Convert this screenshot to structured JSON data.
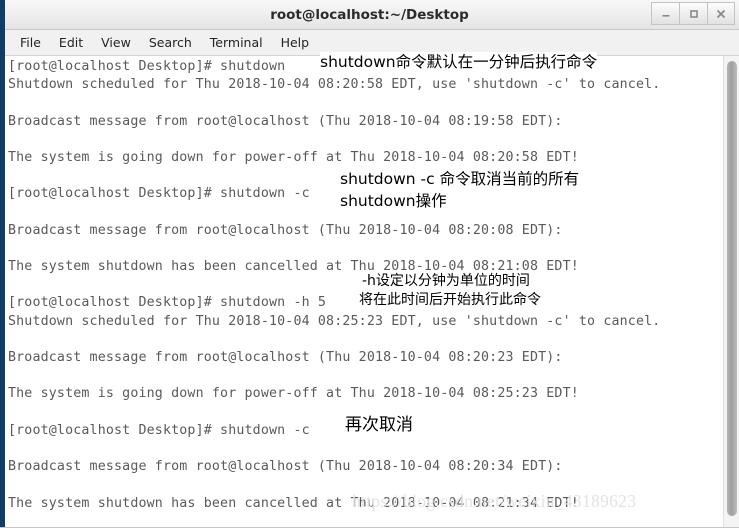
{
  "window": {
    "title": "root@localhost:~/Desktop",
    "frame_color": "#0f3d68",
    "titlebar_bg": "#eeeeee",
    "controls": [
      {
        "name": "minimize",
        "glyph": "–"
      },
      {
        "name": "maximize",
        "glyph": "□"
      },
      {
        "name": "close",
        "glyph": "✕"
      }
    ]
  },
  "menubar": {
    "items": [
      {
        "label": "File"
      },
      {
        "label": "Edit"
      },
      {
        "label": "View"
      },
      {
        "label": "Search"
      },
      {
        "label": "Terminal"
      },
      {
        "label": "Help"
      }
    ]
  },
  "terminal": {
    "text_color": "#5a5a5a",
    "background": "#ffffff",
    "lines": [
      "[root@localhost Desktop]# shutdown",
      "Shutdown scheduled for Thu 2018-10-04 08:20:58 EDT, use 'shutdown -c' to cancel.",
      "",
      "Broadcast message from root@localhost (Thu 2018-10-04 08:19:58 EDT):",
      "",
      "The system is going down for power-off at Thu 2018-10-04 08:20:58 EDT!",
      "",
      "[root@localhost Desktop]# shutdown -c",
      "",
      "Broadcast message from root@localhost (Thu 2018-10-04 08:20:08 EDT):",
      "",
      "The system shutdown has been cancelled at Thu 2018-10-04 08:21:08 EDT!",
      "",
      "[root@localhost Desktop]# shutdown -h 5",
      "Shutdown scheduled for Thu 2018-10-04 08:25:23 EDT, use 'shutdown -c' to cancel.",
      "",
      "Broadcast message from root@localhost (Thu 2018-10-04 08:20:23 EDT):",
      "",
      "The system is going down for power-off at Thu 2018-10-04 08:25:23 EDT!",
      "",
      "[root@localhost Desktop]# shutdown -c",
      "",
      "Broadcast message from root@localhost (Thu 2018-10-04 08:20:34 EDT):",
      "",
      "The system shutdown has been cancelled at Thu 2018-10-04 08:21:34 EDT!"
    ]
  },
  "annotations": {
    "a1": "shutdown命令默认在一分钟后执行命令",
    "a2": "shutdown -c 命令取消当前的所有\nshutdown操作",
    "a3": "-h设定以分钟为单位的时间",
    "a4": "将在此时间后开始执行此命令",
    "a5": "再次取消"
  },
  "watermark": {
    "text": "https://blog.csdn.net/weixin_43189623"
  },
  "scrollbar": {
    "orientation": "vertical",
    "thumb_color": "#a8a8a8"
  }
}
